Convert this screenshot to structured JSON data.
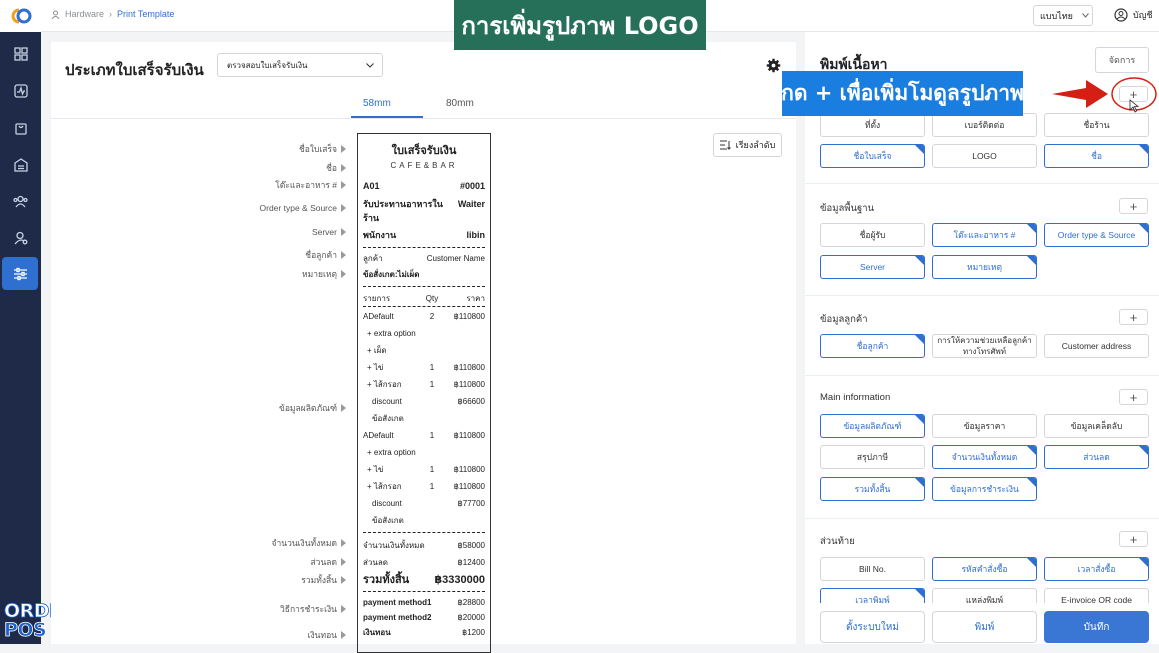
{
  "banner": {
    "text": "การเพิ่มรูปภาพ LOGO"
  },
  "callout": {
    "text": "กด + เพื่อเพิ่มโมดูลรูปภาพ"
  },
  "brand": {
    "line1": "ORDER",
    "line2": "POS"
  },
  "breadcrumb": {
    "root": "Hardware",
    "current": "Print Template"
  },
  "topbar": {
    "language": "แบบไทย",
    "account": "บัญชี"
  },
  "left": {
    "title": "ประเภทใบเสร็จรับเงิน",
    "dropdown": "ตรวจสอบใบเสร็จรับเงิน",
    "tabs": [
      "58mm",
      "80mm"
    ],
    "sort_label": "เรียงลำดับ",
    "labels": [
      "ชื่อใบเสร็จ",
      "ชื่อ",
      "โต๊ะและอาหาร #",
      "Order type & Source",
      "Server",
      "ชื่อลูกค้า",
      "หมายเหตุ",
      "ข้อมูลผลิตภัณฑ์",
      "จำนวนเงินทั้งหมด",
      "ส่วนลด",
      "รวมทั้งสิ้น",
      "วิธีการชำระเงิน",
      "เงินทอน"
    ]
  },
  "receipt": {
    "title": "ใบเสร็จรับเงิน",
    "subtitle": "CAFE&BAR",
    "table": "A01",
    "order_no": "#0001",
    "dine": "รับประทานอาหารในร้าน",
    "waiter": "Waiter",
    "staff_label": "พนักงาน",
    "staff_name": "libin",
    "customer_label": "ลูกค้า",
    "customer_name": "Customer Name",
    "remark": "ข้อสั่งเกต:ไม่เผ็ด",
    "col_item": "รายการ",
    "col_qty": "Qty",
    "col_price": "ราคา",
    "items": [
      {
        "name": "ADefault",
        "qty": "2",
        "price": "฿110800"
      },
      {
        "name": "+ extra option",
        "qty": "",
        "price": ""
      },
      {
        "name": "+ เผ็ด",
        "qty": "",
        "price": ""
      },
      {
        "name": "+ ไข่",
        "qty": "1",
        "price": "฿110800"
      },
      {
        "name": "+ ไส้กรอก",
        "qty": "1",
        "price": "฿110800"
      },
      {
        "name": "discount",
        "qty": "",
        "price": "฿66600"
      },
      {
        "name": "ข้อสังเกต",
        "qty": "",
        "price": ""
      },
      {
        "name": "ADefault",
        "qty": "1",
        "price": "฿110800"
      },
      {
        "name": "+ extra option",
        "qty": "",
        "price": ""
      },
      {
        "name": "+ ไข่",
        "qty": "1",
        "price": "฿110800"
      },
      {
        "name": "+ ไส้กรอก",
        "qty": "1",
        "price": "฿110800"
      },
      {
        "name": "discount",
        "qty": "",
        "price": "฿77700"
      },
      {
        "name": "ข้อสังเกต",
        "qty": "",
        "price": ""
      }
    ],
    "subtotal_label": "จำนวนเงินทั้งหมด",
    "subtotal": "฿58000",
    "discount_label": "ส่วนลด",
    "discount": "฿12400",
    "total_label": "รวมทั้งสิ้น",
    "total": "฿3330000",
    "pay1_label": "payment method1",
    "pay1": "฿28800",
    "pay2_label": "payment method2",
    "pay2": "฿20000",
    "change_label": "เงินทอน",
    "change": "฿1200"
  },
  "right": {
    "title": "พิมพ์เนื้อหา",
    "manage": "จัดการ",
    "header_chips": [
      "ที่ตั้ง",
      "เบอร์ติดต่อ",
      "ชื่อร้าน",
      "ชื่อใบเสร็จ",
      "LOGO",
      "ชื่อ"
    ],
    "basic_title": "ข้อมูลพื้นฐาน",
    "basic_chips": [
      "ชื่อผู้รับ",
      "โต๊ะและอาหาร #",
      "Order type & Source",
      "Server",
      "หมายเหตุ"
    ],
    "customer_title": "ข้อมูลลูกค้า",
    "customer_chips": [
      "ชื่อลูกค้า",
      "การให้ความช่วยเหลือลูกค้าทางโทรศัพท์",
      "Customer address"
    ],
    "main_title": "Main information",
    "main_chips": [
      "ข้อมูลผลิตภัณฑ์",
      "ข้อมูลราคา",
      "ข้อมูลเคล็ดลับ",
      "สรุปภาษี",
      "จำนวนเงินทั้งหมด",
      "ส่วนลด",
      "รวมทั้งสิ้น",
      "ข้อมูลการชำระเงิน"
    ],
    "footer_title": "ส่วนท้าย",
    "footer_chips": [
      "Bill No.",
      "รหัสคำสั่งซื้อ",
      "เวลาสั่งซื้อ",
      "เวลาพิมพ์",
      "แหล่งพิมพ์",
      "E-invoice QR code"
    ],
    "reset": "ตั้งระบบใหม่",
    "print": "พิมพ์",
    "save": "บันทึก",
    "plus": "+"
  }
}
